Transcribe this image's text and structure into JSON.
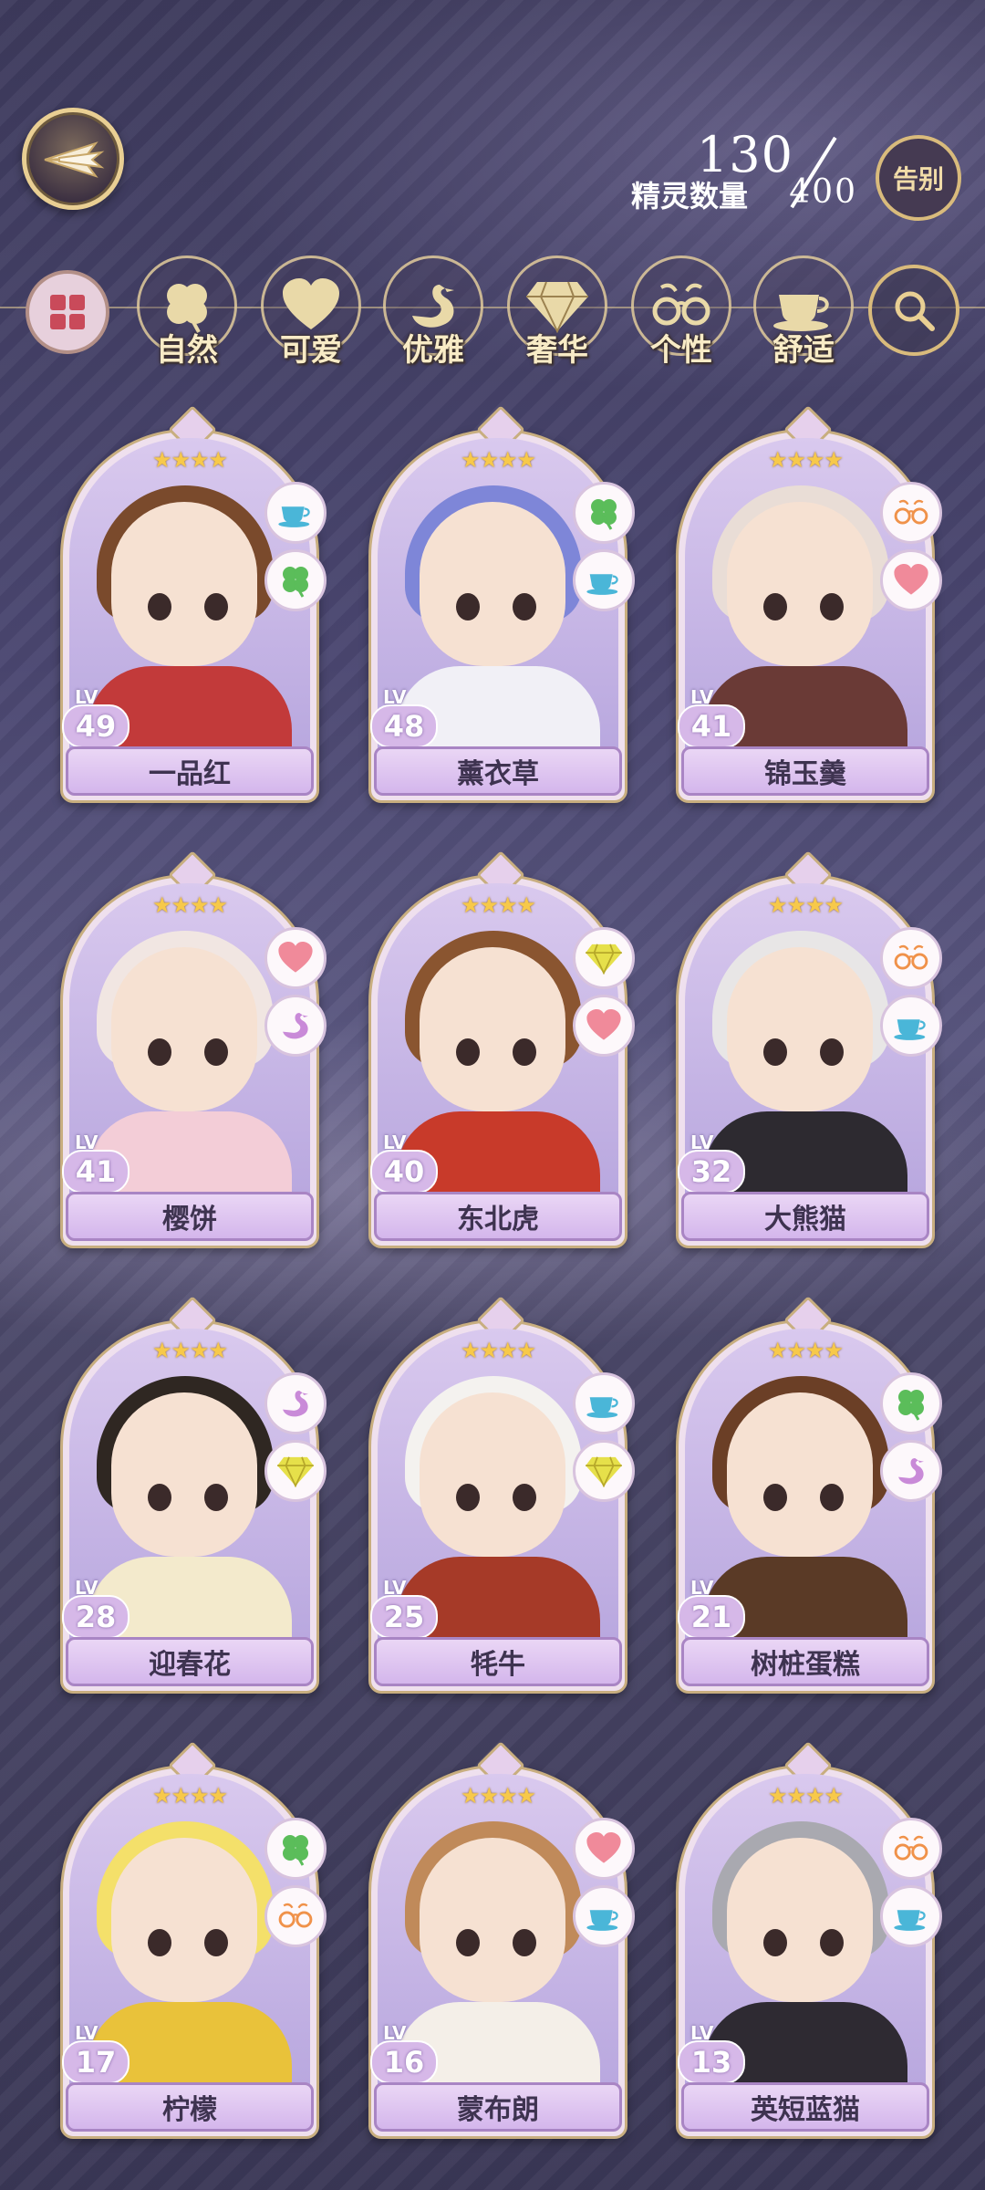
{
  "header": {
    "current_count": "130",
    "count_label": "精灵数量",
    "max_count": "400",
    "farewell_label": "告别"
  },
  "filters": [
    {
      "label": "自然",
      "icon": "clover-icon"
    },
    {
      "label": "可爱",
      "icon": "heart-icon"
    },
    {
      "label": "优雅",
      "icon": "swan-icon"
    },
    {
      "label": "奢华",
      "icon": "diamond-icon"
    },
    {
      "label": "个性",
      "icon": "glasses-icon"
    },
    {
      "label": "舒适",
      "icon": "teacup-icon"
    }
  ],
  "colors": {
    "accent_gold": "#e9cf93",
    "card_name_bg": "#d4b6ec",
    "star": "#f7c94a"
  },
  "cards": [
    {
      "name": "一品红",
      "level": "49",
      "level_label": "LV",
      "stars": "★★★★",
      "traits": [
        "teacup-icon",
        "clover-icon"
      ],
      "hair": "#7a4a2c",
      "outfit": "#c23a3a"
    },
    {
      "name": "薰衣草",
      "level": "48",
      "level_label": "LV",
      "stars": "★★★★",
      "traits": [
        "clover-icon",
        "teacup-icon"
      ],
      "hair": "#7e86d8",
      "outfit": "#f1f0f6"
    },
    {
      "name": "锦玉羹",
      "level": "41",
      "level_label": "LV",
      "stars": "★★★★",
      "traits": [
        "glasses-icon",
        "heart-icon"
      ],
      "hair": "#e9ddd6",
      "outfit": "#6a3a36"
    },
    {
      "name": "樱饼",
      "level": "41",
      "level_label": "LV",
      "stars": "★★★★",
      "traits": [
        "heart-icon",
        "swan-icon"
      ],
      "hair": "#f1e6e2",
      "outfit": "#f3cdd7"
    },
    {
      "name": "东北虎",
      "level": "40",
      "level_label": "LV",
      "stars": "★★★★",
      "traits": [
        "diamond-icon",
        "heart-icon"
      ],
      "hair": "#8a5530",
      "outfit": "#c83a2a"
    },
    {
      "name": "大熊猫",
      "level": "32",
      "level_label": "LV",
      "stars": "★★★★",
      "traits": [
        "glasses-icon",
        "teacup-icon"
      ],
      "hair": "#e8e6e6",
      "outfit": "#2d2a30"
    },
    {
      "name": "迎春花",
      "level": "28",
      "level_label": "LV",
      "stars": "★★★★",
      "traits": [
        "swan-icon",
        "diamond-icon"
      ],
      "hair": "#2f2722",
      "outfit": "#f3eacc"
    },
    {
      "name": "牦牛",
      "level": "25",
      "level_label": "LV",
      "stars": "★★★★",
      "traits": [
        "teacup-icon",
        "diamond-icon"
      ],
      "hair": "#f4f2ef",
      "outfit": "#a63a28"
    },
    {
      "name": "树桩蛋糕",
      "level": "21",
      "level_label": "LV",
      "stars": "★★★★",
      "traits": [
        "clover-icon",
        "swan-icon"
      ],
      "hair": "#6b3f26",
      "outfit": "#5a3a26"
    },
    {
      "name": "柠檬",
      "level": "17",
      "level_label": "LV",
      "stars": "★★★★",
      "traits": [
        "clover-icon",
        "glasses-icon"
      ],
      "hair": "#f4e06a",
      "outfit": "#e9c23a"
    },
    {
      "name": "蒙布朗",
      "level": "16",
      "level_label": "LV",
      "stars": "★★★★",
      "traits": [
        "heart-icon",
        "teacup-icon"
      ],
      "hair": "#c08a5a",
      "outfit": "#f4efe8"
    },
    {
      "name": "英短蓝猫",
      "level": "13",
      "level_label": "LV",
      "stars": "★★★★",
      "traits": [
        "glasses-icon",
        "teacup-icon"
      ],
      "hair": "#a9a9b0",
      "outfit": "#2e2a32"
    }
  ]
}
